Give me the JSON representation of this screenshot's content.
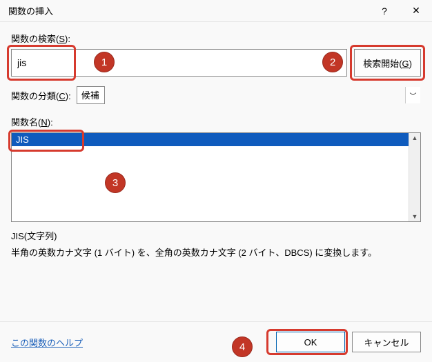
{
  "titlebar": {
    "title": "関数の挿入",
    "help": "?",
    "close": "✕"
  },
  "search": {
    "label_pre": "関数の検索(",
    "label_u": "S",
    "label_post": "):",
    "value": "jis",
    "button_pre": "検索開始(",
    "button_u": "G",
    "button_post": ")"
  },
  "category": {
    "label_pre": "関数の分類(",
    "label_u": "C",
    "label_post": "):",
    "selected": "候補"
  },
  "function_name": {
    "label_pre": "関数名(",
    "label_u": "N",
    "label_post": "):",
    "items": [
      "JIS"
    ]
  },
  "preview": {
    "syntax": "JIS(文字列)",
    "description": "半角の英数カナ文字 (1 バイト) を、全角の英数カナ文字 (2 バイト、DBCS) に変換します。"
  },
  "footer": {
    "help_link": "この関数のヘルプ",
    "ok": "OK",
    "cancel": "キャンセル"
  },
  "badges": {
    "b1": "1",
    "b2": "2",
    "b3": "3",
    "b4": "4"
  }
}
